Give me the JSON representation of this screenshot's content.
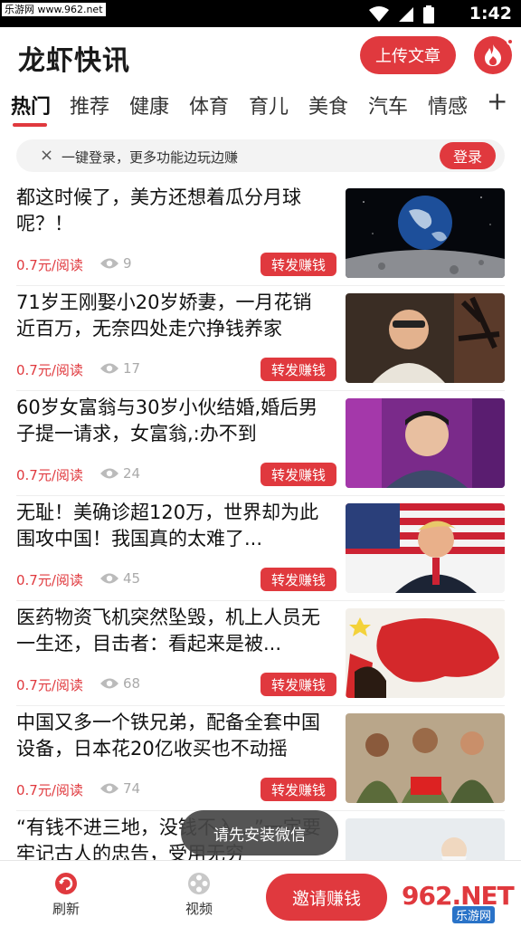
{
  "statusbar": {
    "watermark": "乐游网 www.962.net",
    "time": "1:42"
  },
  "header": {
    "app_title": "龙虾快讯",
    "upload_label": "上传文章",
    "hot_icon": "flame-icon"
  },
  "tabs": [
    "热门",
    "推荐",
    "健康",
    "体育",
    "育儿",
    "美食",
    "汽车",
    "情感"
  ],
  "tabs_add": "+",
  "login_banner": {
    "close": "×",
    "text": "一键登录，更多功能边玩边赚",
    "button": "登录"
  },
  "feed": [
    {
      "title": "都这时候了，美方还想着瓜分月球呢？！",
      "price": "0.7元/阅读",
      "views": "9",
      "share": "转发赚钱",
      "thumb": "earth-from-moon-image"
    },
    {
      "title": "71岁王刚娶小20岁娇妻，一月花销近百万，无奈四处走穴挣钱养家",
      "price": "0.7元/阅读",
      "views": "17",
      "share": "转发赚钱",
      "thumb": "man-in-studio-image"
    },
    {
      "title": "60岁女富翁与30岁小伙结婚,婚后男子提一请求，女富翁,:办不到",
      "price": "0.7元/阅读",
      "views": "24",
      "share": "转发赚钱",
      "thumb": "young-man-on-stage-image"
    },
    {
      "title": "无耻！美确诊超120万，世界却为此围攻中国！我国真的太难了...",
      "price": "0.7元/阅读",
      "views": "45",
      "share": "转发赚钱",
      "thumb": "politician-at-podium-image"
    },
    {
      "title": "医药物资飞机突然坠毁，机上人员无一生还，目击者：看起来是被...",
      "price": "0.7元/阅读",
      "views": "68",
      "share": "转发赚钱",
      "thumb": "red-map-poster-image"
    },
    {
      "title": "中国又多一个铁兄弟，配备全套中国设备，日本花20亿收买也不动摇",
      "price": "0.7元/阅读",
      "views": "74",
      "share": "转发赚钱",
      "thumb": "soldiers-group-image"
    },
    {
      "title": "“有钱不进三地，没钱不入…”一定要牢记古人的忠告，受用无穷",
      "price": "",
      "views": "",
      "share": "",
      "thumb": "elder-painting-image"
    }
  ],
  "toast": "请先安装微信",
  "bottombar": {
    "refresh": "刷新",
    "video": "视频",
    "invite": "邀请赚钱",
    "watermark_big": "962.NET",
    "watermark_small": "乐游网"
  },
  "colors": {
    "accent": "#e0393e",
    "text": "#111111",
    "muted": "#aaaaaa"
  }
}
